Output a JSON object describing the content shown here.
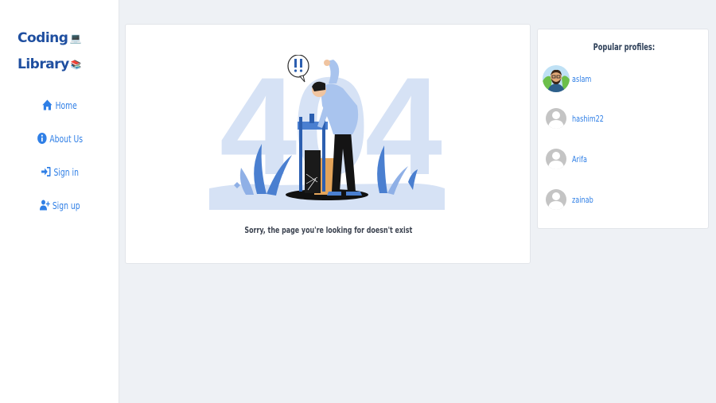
{
  "brand": {
    "line1": "Coding",
    "line1_emoji": "💻",
    "line2": "Library",
    "line2_emoji": "📚"
  },
  "nav": {
    "items": [
      {
        "label": "Home",
        "icon": "home-icon"
      },
      {
        "label": "About Us",
        "icon": "info-circle-icon"
      },
      {
        "label": "Sign in",
        "icon": "sign-in-icon"
      },
      {
        "label": "Sign up",
        "icon": "user-plus-icon"
      }
    ]
  },
  "error": {
    "code": "404",
    "message": "Sorry, the page you're looking for doesn't exist"
  },
  "profiles": {
    "title": "Popular profiles:",
    "items": [
      {
        "name": "aslam",
        "avatar": "photo-avatar"
      },
      {
        "name": "hashim22",
        "avatar": "default-avatar"
      },
      {
        "name": "Arifa",
        "avatar": "default-avatar"
      },
      {
        "name": "zainab",
        "avatar": "default-avatar"
      }
    ]
  },
  "colors": {
    "accent": "#2f7fe6",
    "brand": "#1f4fa0",
    "background": "#eef1f5",
    "illustration_light": "#d6e2f5",
    "illustration_mid": "#4a7fd0"
  }
}
